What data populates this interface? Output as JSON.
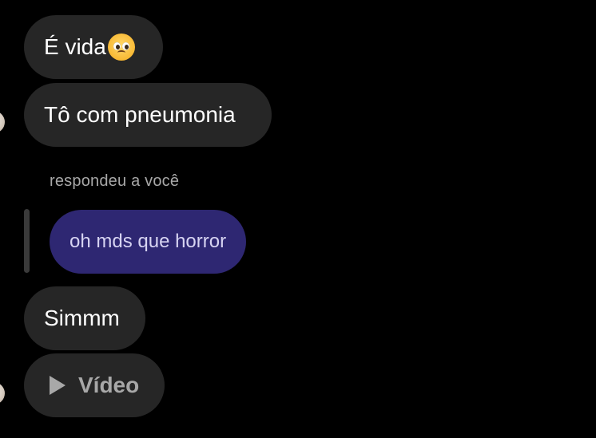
{
  "messages": {
    "msg1": {
      "text": "É vida",
      "emoji": "pleading-face-emoji"
    },
    "msg2": {
      "text": "Tô com pneumonia"
    },
    "reply": {
      "meta": "respondeu a você",
      "quoted_text": "oh mds que horror"
    },
    "msg3": {
      "text": "Simmm"
    },
    "msg4": {
      "label": "Vídeo",
      "icon": "play-icon"
    }
  },
  "colors": {
    "background": "#000000",
    "bubble": "#262626",
    "reply_bubble": "#2e2772",
    "reply_text": "#d7d4f2",
    "secondary_text": "#a8a8a8"
  }
}
